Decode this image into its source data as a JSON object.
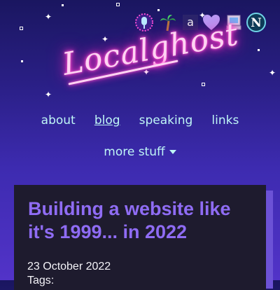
{
  "header": {
    "logo_text": "Localghost",
    "badges": [
      {
        "icon": "microphone-icon"
      },
      {
        "icon": "palm-tree-icon"
      },
      {
        "icon": "amazon-icon"
      },
      {
        "icon": "heart-icon"
      },
      {
        "icon": "computer-icon"
      },
      {
        "icon": "netscape-icon",
        "label": "N"
      }
    ]
  },
  "nav": {
    "items": [
      {
        "label": "about"
      },
      {
        "label": "blog"
      },
      {
        "label": "speaking"
      },
      {
        "label": "links"
      }
    ],
    "more_label": "more stuff"
  },
  "post": {
    "title": "Building a website like it's 1999... in 2022",
    "date": "23 October 2022",
    "tags_label": "Tags:"
  },
  "colors": {
    "link": "#bff6f6",
    "title": "#8f6cf4",
    "card_bg": "#1e1b2e",
    "neon": "#ff3ecb"
  }
}
